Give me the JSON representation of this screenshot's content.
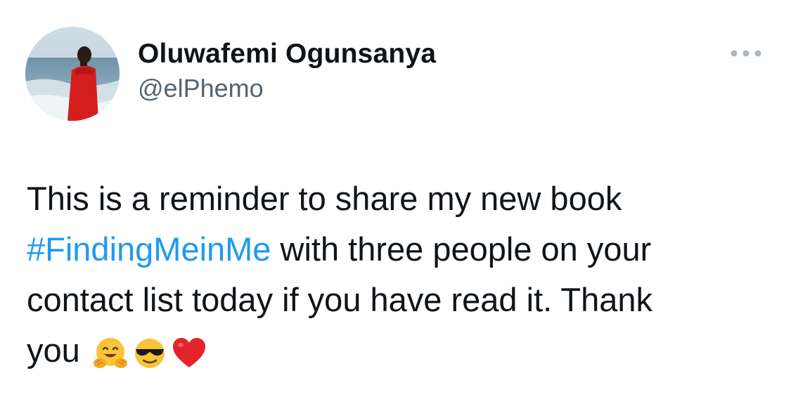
{
  "author": {
    "display_name": "Oluwafemi Ogunsanya",
    "handle": "@elPhemo"
  },
  "tweet": {
    "line1": "This is a reminder to share my new book",
    "hashtag": "#FindingMeinMe",
    "line2_rest": " with three people on your",
    "line3": "contact list today if you have read it. Thank",
    "line4": "you "
  },
  "icons": {
    "more": "more-options-icon",
    "emojis": [
      "hugging-face-icon",
      "sunglasses-face-icon",
      "red-heart-icon"
    ]
  },
  "colors": {
    "text": "#0f1419",
    "secondary": "#536471",
    "link": "#1d9bf0",
    "background": "#ffffff"
  }
}
